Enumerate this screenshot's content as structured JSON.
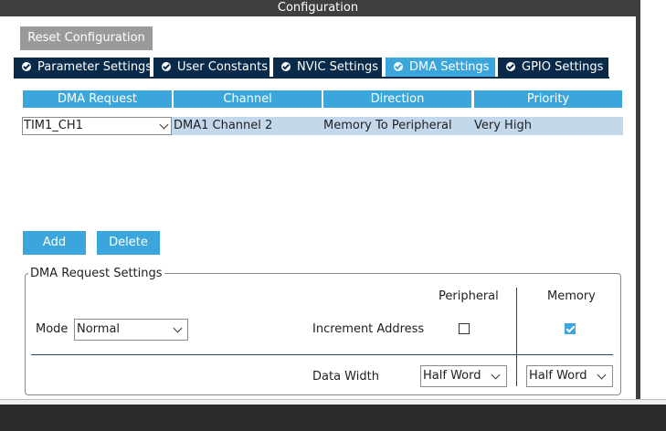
{
  "window": {
    "title": "Configuration"
  },
  "toolbar": {
    "reset_label": "Reset Configuration"
  },
  "tabs": [
    {
      "label": "Parameter Settings",
      "icon": "check-circle-icon",
      "active": false
    },
    {
      "label": "User Constants",
      "icon": "check-circle-icon",
      "active": false
    },
    {
      "label": "NVIC Settings",
      "icon": "check-circle-icon",
      "active": false
    },
    {
      "label": "DMA Settings",
      "icon": "check-circle-icon",
      "active": true
    },
    {
      "label": "GPIO Settings",
      "icon": "check-circle-icon",
      "active": false
    }
  ],
  "table": {
    "columns": [
      "DMA Request",
      "Channel",
      "Direction",
      "Priority"
    ],
    "rows": [
      {
        "request": "TIM1_CH1",
        "channel": "DMA1 Channel 2",
        "direction": "Memory To Peripheral",
        "priority": "Very High"
      }
    ]
  },
  "actions": {
    "add_label": "Add",
    "delete_label": "Delete"
  },
  "settings": {
    "group_title": "DMA Request Settings",
    "mode_label": "Mode",
    "mode_value": "Normal",
    "peripheral_header": "Peripheral",
    "memory_header": "Memory",
    "increment_label": "Increment Address",
    "peripheral_increment": false,
    "memory_increment": true,
    "data_width_label": "Data Width",
    "peripheral_width": "Half Word",
    "memory_width": "Half Word"
  },
  "colors": {
    "accent": "#3ba6dc",
    "tab_dark": "#0a2a4a",
    "row_selected": "#c4d8ec",
    "title_bar": "#3f3f3f"
  }
}
